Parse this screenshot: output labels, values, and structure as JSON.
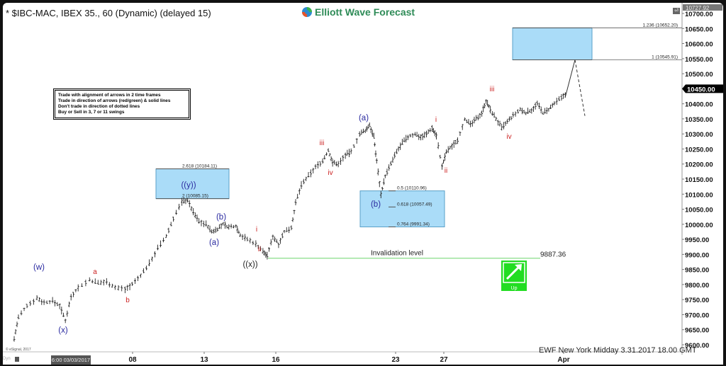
{
  "header": {
    "title": "* $IBC-MAC, IBEX 35., 60 (Dynamic) (delayed 15)",
    "logo_text": "Elliott Wave Forecast"
  },
  "note_box": {
    "lines": [
      "Trade with alignment of arrows in 2 time frames",
      "Trade in direction of arrows (red/green) & solid lines",
      "Don't trade in direction of dotted lines",
      "Buy or Sell in 3, 7 or 11 swings"
    ]
  },
  "footer": {
    "text": "EWF New York Midday 3.31.2017 18.00 GMT",
    "copyright": "© eSignal, 2017",
    "dyn_label": "Dyn",
    "start_date": "6:00 03/03/2017"
  },
  "signal": {
    "label": "Up",
    "color": "#22dd22"
  },
  "colors": {
    "box_fill": "#aadcf8",
    "box_border": "#5aa0c8",
    "blue_label": "#2a2aa0",
    "red_label": "#cc2222",
    "invalidation_line": "#88dd88",
    "bars": "#222222"
  },
  "chart_data": {
    "type": "ohlc-bar",
    "title": "* $IBC-MAC, IBEX 35., 60 (Dynamic) (delayed 15)",
    "ylim": [
      9600,
      10700
    ],
    "yticks": [
      10700,
      10650,
      10600,
      10550,
      10500,
      10450,
      10400,
      10350,
      10300,
      10250,
      10200,
      10150,
      10100,
      10050,
      10000,
      9950,
      9900,
      9850,
      9800,
      9750,
      9700,
      9650,
      9600
    ],
    "ytick_labels": [
      "10700.00",
      "10650.00",
      "10600.00",
      "10550.00",
      "10500.00",
      "10450.00",
      "10400.00",
      "10350.00",
      "10300.00",
      "10250.00",
      "10200.00",
      "10150.00",
      "10100.00",
      "10050.00",
      "10000.00",
      "9950.00",
      "9900.00",
      "9850.00",
      "9800.00",
      "9750.00",
      "9700.00",
      "9650.00",
      "9600.00"
    ],
    "xticks": [
      {
        "label": "08",
        "day": 8
      },
      {
        "label": "13",
        "day": 13
      },
      {
        "label": "16",
        "day": 16
      },
      {
        "label": "23",
        "day": 23
      },
      {
        "label": "27",
        "day": 27
      },
      {
        "label": "Apr",
        "day": 32
      }
    ],
    "high_marker": "10727.92",
    "last_price": "10450.00",
    "price_path": [
      [
        3.3,
        9620
      ],
      [
        3.6,
        9690
      ],
      [
        4.2,
        9730
      ],
      [
        4.9,
        9755
      ],
      [
        5.4,
        9740
      ],
      [
        6.0,
        9745
      ],
      [
        6.5,
        9730
      ],
      [
        6.9,
        9680
      ],
      [
        7.3,
        9760
      ],
      [
        7.8,
        9790
      ],
      [
        8.6,
        9815
      ],
      [
        9.2,
        9805
      ],
      [
        9.8,
        9810
      ],
      [
        10.4,
        9790
      ],
      [
        11.1,
        9785
      ],
      [
        11.6,
        9800
      ],
      [
        12.2,
        9830
      ],
      [
        12.8,
        9870
      ],
      [
        13.4,
        9920
      ],
      [
        14.0,
        9960
      ],
      [
        14.5,
        10020
      ],
      [
        15.1,
        10075
      ],
      [
        15.5,
        10080
      ],
      [
        15.9,
        10040
      ],
      [
        16.3,
        10010
      ],
      [
        16.8,
        10000
      ],
      [
        17.2,
        9975
      ],
      [
        17.6,
        9985
      ],
      [
        18.0,
        10000
      ],
      [
        18.4,
        9990
      ],
      [
        18.9,
        9995
      ],
      [
        19.2,
        9965
      ],
      [
        19.7,
        9950
      ],
      [
        20.3,
        9935
      ],
      [
        20.8,
        9910
      ],
      [
        21.1,
        9895
      ],
      [
        21.5,
        9960
      ],
      [
        21.9,
        9935
      ],
      [
        22.3,
        9975
      ],
      [
        22.8,
        9990
      ],
      [
        23.1,
        10070
      ],
      [
        23.5,
        10130
      ],
      [
        24.0,
        10160
      ],
      [
        24.5,
        10190
      ],
      [
        25.0,
        10210
      ],
      [
        25.4,
        10245
      ],
      [
        25.7,
        10205
      ],
      [
        26.1,
        10200
      ],
      [
        26.6,
        10230
      ],
      [
        27.0,
        10240
      ],
      [
        27.6,
        10300
      ],
      [
        28.0,
        10310
      ],
      [
        28.3,
        10330
      ],
      [
        28.6,
        10290
      ],
      [
        28.8,
        10210
      ],
      [
        29.1,
        10100
      ],
      [
        29.4,
        10160
      ],
      [
        29.8,
        10200
      ],
      [
        30.2,
        10240
      ],
      [
        30.6,
        10270
      ],
      [
        31.0,
        10290
      ],
      [
        31.5,
        10300
      ],
      [
        31.9,
        10290
      ],
      [
        32.3,
        10300
      ],
      [
        32.7,
        10320
      ],
      [
        33.0,
        10295
      ],
      [
        33.4,
        10190
      ],
      [
        33.7,
        10240
      ],
      [
        34.1,
        10260
      ],
      [
        34.5,
        10280
      ],
      [
        35.0,
        10350
      ],
      [
        35.4,
        10330
      ],
      [
        35.8,
        10350
      ],
      [
        36.2,
        10370
      ],
      [
        36.5,
        10410
      ],
      [
        36.8,
        10380
      ],
      [
        37.2,
        10350
      ],
      [
        37.6,
        10320
      ],
      [
        38.0,
        10340
      ],
      [
        38.4,
        10360
      ],
      [
        38.9,
        10380
      ],
      [
        39.3,
        10370
      ],
      [
        39.7,
        10380
      ],
      [
        40.1,
        10400
      ],
      [
        40.5,
        10370
      ],
      [
        40.9,
        10380
      ],
      [
        41.3,
        10400
      ],
      [
        41.8,
        10420
      ],
      [
        42.2,
        10440
      ]
    ],
    "projection": {
      "solid": [
        [
          42.6,
          10420
        ],
        [
          43.6,
          10545.91
        ]
      ],
      "dotted": [
        [
          43.6,
          10545.91
        ],
        [
          44.5,
          10360
        ]
      ]
    },
    "fib_boxes": [
      {
        "name": "y-target",
        "from_day": 12.9,
        "to_day": 16.1,
        "top": 10184.11,
        "bottom": 10085.15,
        "labels": [
          {
            "text": "2.618 (10184.11)",
            "price": 10184.11
          },
          {
            "text": "2 (10085.15)",
            "price": 10085.15
          }
        ]
      },
      {
        "name": "b-target",
        "from_day": 28.4,
        "to_day": 32.9,
        "top": 10110.96,
        "bottom": 9991.34,
        "labels": [
          {
            "text": "0.5 (10110.96)",
            "price": 10110.96
          },
          {
            "text": "0.618 (10057.49)",
            "price": 10057.49
          },
          {
            "text": "0.764 (9991.34)",
            "price": 9991.34
          }
        ]
      },
      {
        "name": "target-area",
        "from_day": 41.5,
        "to_day": 47.6,
        "top": 10652.2,
        "bottom": 10545.91,
        "labels": [
          {
            "text": "1.236 (10652.20)",
            "price": 10652.2
          },
          {
            "text": "1 (10545.91)",
            "price": 10545.91
          }
        ]
      }
    ],
    "invalidation": {
      "label": "Invalidation level",
      "value": "9887.36",
      "price": 9887.36
    },
    "wave_labels": [
      {
        "text": "(w)",
        "day": 5.0,
        "price": 9785,
        "color": "blue"
      },
      {
        "text": "(x)",
        "day": 6.9,
        "price": 9645,
        "color": "blue"
      },
      {
        "text": "a",
        "day": 8.4,
        "price": 9835,
        "color": "red"
      },
      {
        "text": "b",
        "day": 10.8,
        "price": 9755,
        "color": "red"
      },
      {
        "text": "((y))",
        "day": 15.0,
        "price": 10115,
        "color": "blue"
      },
      {
        "text": "(a)",
        "day": 17.6,
        "price": 9930,
        "color": "blue"
      },
      {
        "text": "(b)",
        "day": 18.5,
        "price": 10020,
        "color": "blue"
      },
      {
        "text": "((x))",
        "day": 20.8,
        "price": 9860,
        "color": "black"
      },
      {
        "text": "i",
        "day": 21.6,
        "price": 9985,
        "color": "red"
      },
      {
        "text": "ii",
        "day": 21.7,
        "price": 9905,
        "color": "red"
      },
      {
        "text": "iii",
        "day": 25.5,
        "price": 10260,
        "color": "red"
      },
      {
        "text": "iv",
        "day": 26.6,
        "price": 10170,
        "color": "red"
      },
      {
        "text": "(a)",
        "day": 28.9,
        "price": 10340,
        "color": "blue"
      },
      {
        "text": "(b)",
        "day": 29.1,
        "price": 10035,
        "color": "blue"
      },
      {
        "text": "i",
        "day": 32.8,
        "price": 10330,
        "color": "red"
      },
      {
        "text": "ii",
        "day": 33.4,
        "price": 10145,
        "color": "red"
      },
      {
        "text": "iii",
        "day": 36.5,
        "price": 10425,
        "color": "red"
      },
      {
        "text": "iv",
        "day": 37.6,
        "price": 10290,
        "color": "red"
      }
    ]
  }
}
